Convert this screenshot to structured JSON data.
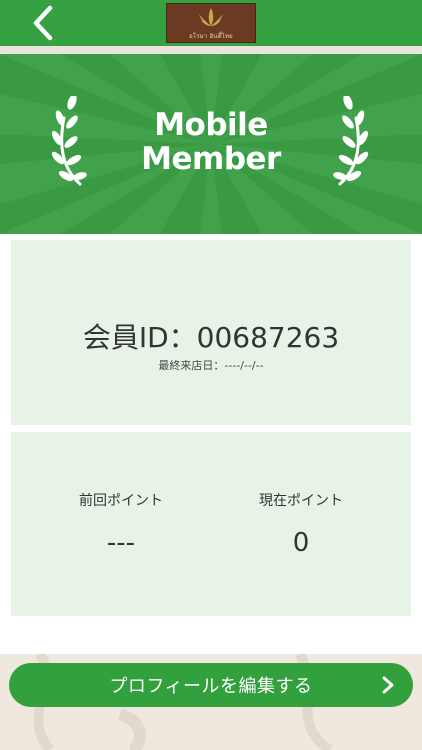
{
  "header": {
    "logo_text": "อโรมา อินดี้ไทย",
    "back_icon": "chevron-left-icon"
  },
  "banner": {
    "title_line1": "Mobile",
    "title_line2": "Member"
  },
  "member": {
    "id_label": "会員ID：00687263",
    "last_visit": "最終来店日：----/--/--"
  },
  "points": {
    "previous_label": "前回ポイント",
    "previous_value": "---",
    "current_label": "現在ポイント",
    "current_value": "0"
  },
  "actions": {
    "edit_profile_label": "プロフィールを編集する"
  },
  "colors": {
    "primary_green": "#35a142",
    "card_bg": "#e7f3e7",
    "banner_green": "#3a9a44"
  }
}
